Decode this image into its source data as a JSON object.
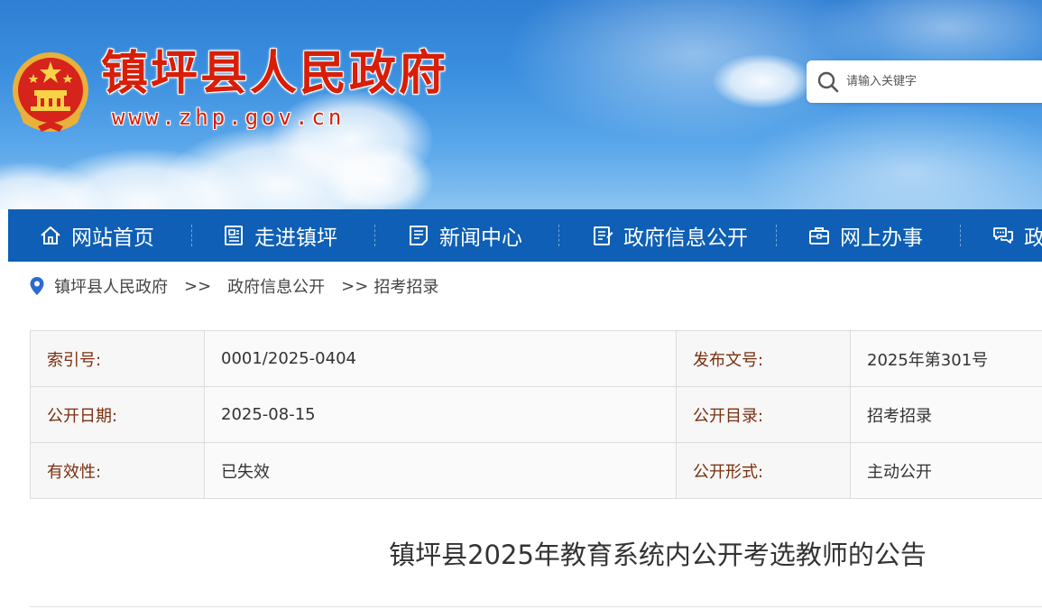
{
  "header": {
    "site_title": "镇坪县人民政府",
    "site_url": "www.zhp.gov.cn",
    "search": {
      "placeholder": "请输入关键字"
    }
  },
  "nav": {
    "items": [
      {
        "label": "网站首页",
        "icon": "home-icon"
      },
      {
        "label": "走进镇坪",
        "icon": "document-panel-icon"
      },
      {
        "label": "新闻中心",
        "icon": "news-icon"
      },
      {
        "label": "政府信息公开",
        "icon": "clipboard-icon"
      },
      {
        "label": "网上办事",
        "icon": "briefcase-icon"
      },
      {
        "label": "政",
        "icon": "chat-bubbles-icon"
      }
    ]
  },
  "breadcrumb": {
    "items": [
      "镇坪县人民政府",
      "政府信息公开",
      "招考招录"
    ],
    "separator": ">>"
  },
  "info": {
    "rows": [
      {
        "label1": "索引号:",
        "value1": "0001/2025-0404",
        "label2": "发布文号:",
        "value2": "2025年第301号"
      },
      {
        "label1": "公开日期:",
        "value1": "2025-08-15",
        "label2": "公开目录:",
        "value2": "招考招录"
      },
      {
        "label1": "有效性:",
        "value1": "已失效",
        "label2": "公开形式:",
        "value2": "主动公开"
      }
    ]
  },
  "article": {
    "title": "镇坪县2025年教育系统内公开考选教师的公告"
  },
  "colors": {
    "nav_bg": "#0e5fb5",
    "title_red": "#d81e06",
    "label_brown": "#7a2f0e"
  }
}
